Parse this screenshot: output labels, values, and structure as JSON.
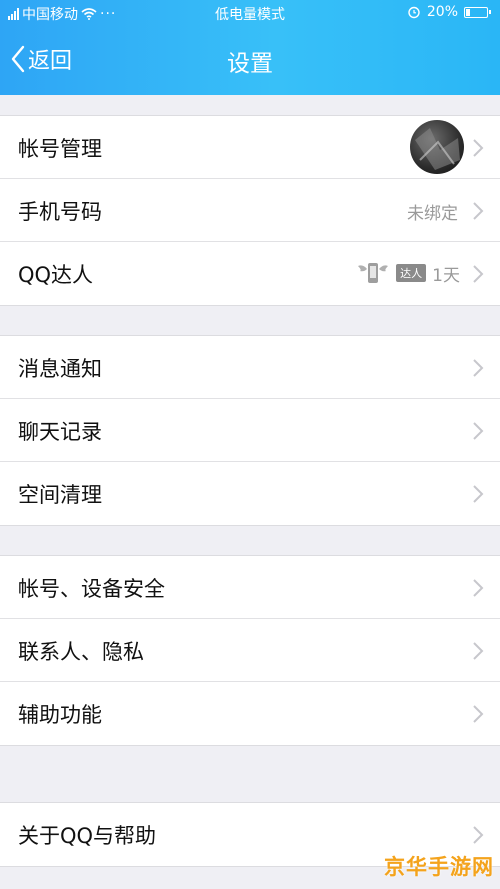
{
  "status_bar": {
    "carrier": "中国移动",
    "mode": "低电量模式",
    "battery_percent": "20%",
    "battery_level": 0.2,
    "icons": [
      "signal-icon",
      "wifi-icon",
      "more-dots-icon",
      "alarm-icon",
      "battery-icon"
    ]
  },
  "header": {
    "back_label": "返回",
    "title": "设置",
    "colors": {
      "gradient_start": "#2ea5f5",
      "gradient_end": "#2ab6f6"
    }
  },
  "groups": [
    {
      "items": [
        {
          "label": "帐号管理",
          "accessory": "avatar"
        },
        {
          "label": "手机号码",
          "value": "未绑定"
        },
        {
          "label": "QQ达人",
          "badge_tag": "达人",
          "badge_value": "1天"
        }
      ]
    },
    {
      "items": [
        {
          "label": "消息通知"
        },
        {
          "label": "聊天记录"
        },
        {
          "label": "空间清理"
        }
      ]
    },
    {
      "items": [
        {
          "label": "帐号、设备安全"
        },
        {
          "label": "联系人、隐私"
        },
        {
          "label": "辅助功能"
        }
      ]
    },
    {
      "items": [
        {
          "label": "关于QQ与帮助"
        }
      ]
    }
  ],
  "watermark": "京华手游网"
}
